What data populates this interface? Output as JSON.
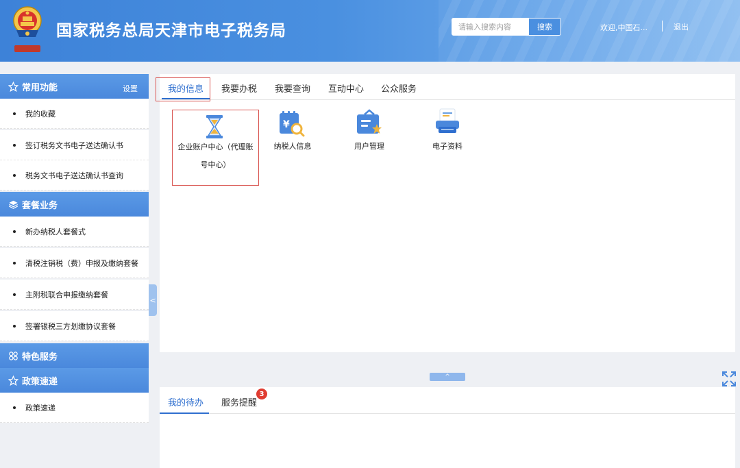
{
  "header": {
    "title": "国家税务总局天津市电子税务局",
    "search_placeholder": "请输入搜索内容",
    "search_label": "搜索",
    "welcome": "欢迎,中国石...",
    "logout": "退出"
  },
  "sidebar": {
    "sections": [
      {
        "title": "常用功能",
        "icon": "star-icon",
        "setting": "设置",
        "items": [
          "我的收藏",
          "签订税务文书电子送达确认书",
          "税务文书电子送达确认书查询"
        ]
      },
      {
        "title": "套餐业务",
        "icon": "layers-icon",
        "items": [
          "新办纳税人套餐式",
          "清税注销税（费）申报及缴纳套餐",
          "主附税联合申报缴纳套餐",
          "签署银税三方划缴协议套餐"
        ]
      },
      {
        "title": "特色服务",
        "icon": "grid-icon",
        "items": []
      },
      {
        "title": "政策速递",
        "icon": "star-icon",
        "items": [
          "政策速递"
        ]
      }
    ],
    "collapse_label": "<"
  },
  "main": {
    "tabs": [
      "我的信息",
      "我要办税",
      "我要查询",
      "互动中心",
      "公众服务"
    ],
    "active_tab": "我的信息",
    "functions": [
      {
        "label_line1": "企业账户中心（代理账",
        "label_line2": "号中心）",
        "icon": "hourglass-icon"
      },
      {
        "label": "纳税人信息",
        "icon": "tax-search-icon"
      },
      {
        "label": "用户管理",
        "icon": "user-manage-icon"
      },
      {
        "label": "电子资料",
        "icon": "printer-icon"
      }
    ]
  },
  "toggle": {
    "up_label": "^"
  },
  "bottom": {
    "tabs": [
      "我的待办",
      "服务提醒"
    ],
    "badge": "3"
  },
  "colors": {
    "primary": "#4a88dc",
    "active_tab": "#2f6fcf",
    "highlight_box": "#d9534f",
    "badge": "#e03c31"
  }
}
